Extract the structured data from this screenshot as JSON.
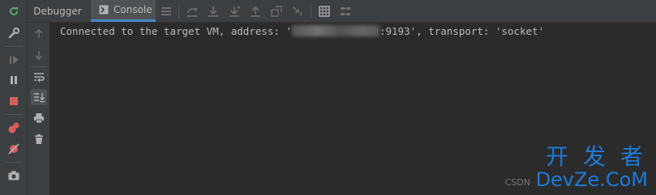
{
  "tabs": [
    {
      "label": "Debugger",
      "active": false
    },
    {
      "label": "Console",
      "active": true
    }
  ],
  "left_toolbar": [
    {
      "name": "rerun-icon",
      "color": "#59a869"
    },
    {
      "name": "wrench-icon",
      "color": "#afb1b3"
    },
    {
      "name": "resume-icon",
      "color": "#6e6e6e"
    },
    {
      "name": "pause-icon",
      "color": "#afb1b3"
    },
    {
      "name": "stop-icon",
      "color": "#db5c5c"
    },
    {
      "name": "view-breakpoints-icon",
      "color": "#db5c5c"
    },
    {
      "name": "mute-breakpoints-icon",
      "color": "#db5c5c"
    },
    {
      "name": "camera-icon",
      "color": "#afb1b3"
    }
  ],
  "console_toolbar": [
    "up-arrow-icon",
    "down-arrow-icon",
    "soft-wrap-icon",
    "scroll-to-end-icon",
    "print-icon",
    "trash-icon"
  ],
  "tab_toolbar": [
    "menu-icon",
    "step-over-icon",
    "step-into-icon",
    "force-step-into-icon",
    "step-out-icon",
    "drop-frame-icon",
    "run-to-cursor-icon",
    "evaluate-icon",
    "trace-icon"
  ],
  "console": {
    "prefix": "Connected to the target VM, address: '",
    "address_hidden": "",
    "suffix": ":9193', transport: 'socket'"
  },
  "watermark": {
    "line1": "开发者",
    "line2": "DevZe.CoM",
    "csdn": "CSDN"
  },
  "colors": {
    "background": "#2b2b2b",
    "toolbar": "#3c3f41",
    "accent": "#4a88c7",
    "text": "#bbbbbb",
    "watermark": "#1e7ad6"
  }
}
